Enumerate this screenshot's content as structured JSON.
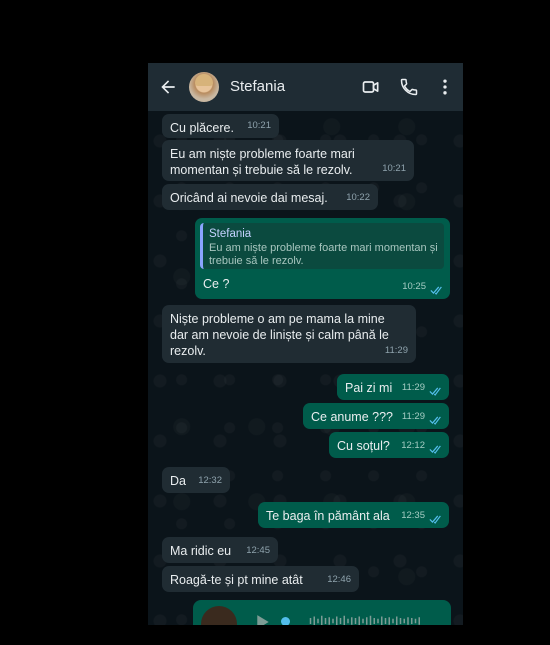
{
  "header": {
    "contact_name": "Stefania"
  },
  "messages": [
    {
      "dir": "in",
      "text": "Cu plăcere.",
      "time": "10:21"
    },
    {
      "dir": "in",
      "text": "Eu am niște probleme foarte mari momentan și trebuie să le rezolv.",
      "time": "10:21"
    },
    {
      "dir": "in",
      "text": "Oricând ai nevoie dai mesaj.",
      "time": "10:22"
    },
    {
      "dir": "out",
      "quote_name": "Stefania",
      "quote_text": "Eu am niște probleme foarte mari momentan și trebuie să le rezolv.",
      "text": "Ce ?",
      "time": "10:25"
    },
    {
      "dir": "in",
      "text": "Niște probleme o am pe mama la mine dar am nevoie de liniște și calm până le rezolv.",
      "time": "11:29"
    },
    {
      "dir": "out",
      "text": "Pai zi mi",
      "time": "11:29"
    },
    {
      "dir": "out",
      "text": "Ce anume ???",
      "time": "11:29"
    },
    {
      "dir": "out",
      "text": "Cu soțul?",
      "time": "12:12"
    },
    {
      "dir": "in",
      "text": "Da",
      "time": "12:32"
    },
    {
      "dir": "out",
      "text": "Te baga în pământ ala",
      "time": "12:35"
    },
    {
      "dir": "in",
      "text": "Ma ridic eu",
      "time": "12:45"
    },
    {
      "dir": "in",
      "text": "Roagă-te și pt mine atât",
      "time": "12:46"
    }
  ],
  "icons": {
    "back": "arrow-left-icon",
    "video": "video-call-icon",
    "call": "phone-icon",
    "menu": "more-vertical-icon",
    "read": "double-check-icon"
  },
  "colors": {
    "header_bg": "#1f2c34",
    "chat_bg": "#0b141a",
    "incoming_bubble": "#202c33",
    "outgoing_bubble": "#005c4b",
    "read_ticks": "#53bdeb"
  }
}
